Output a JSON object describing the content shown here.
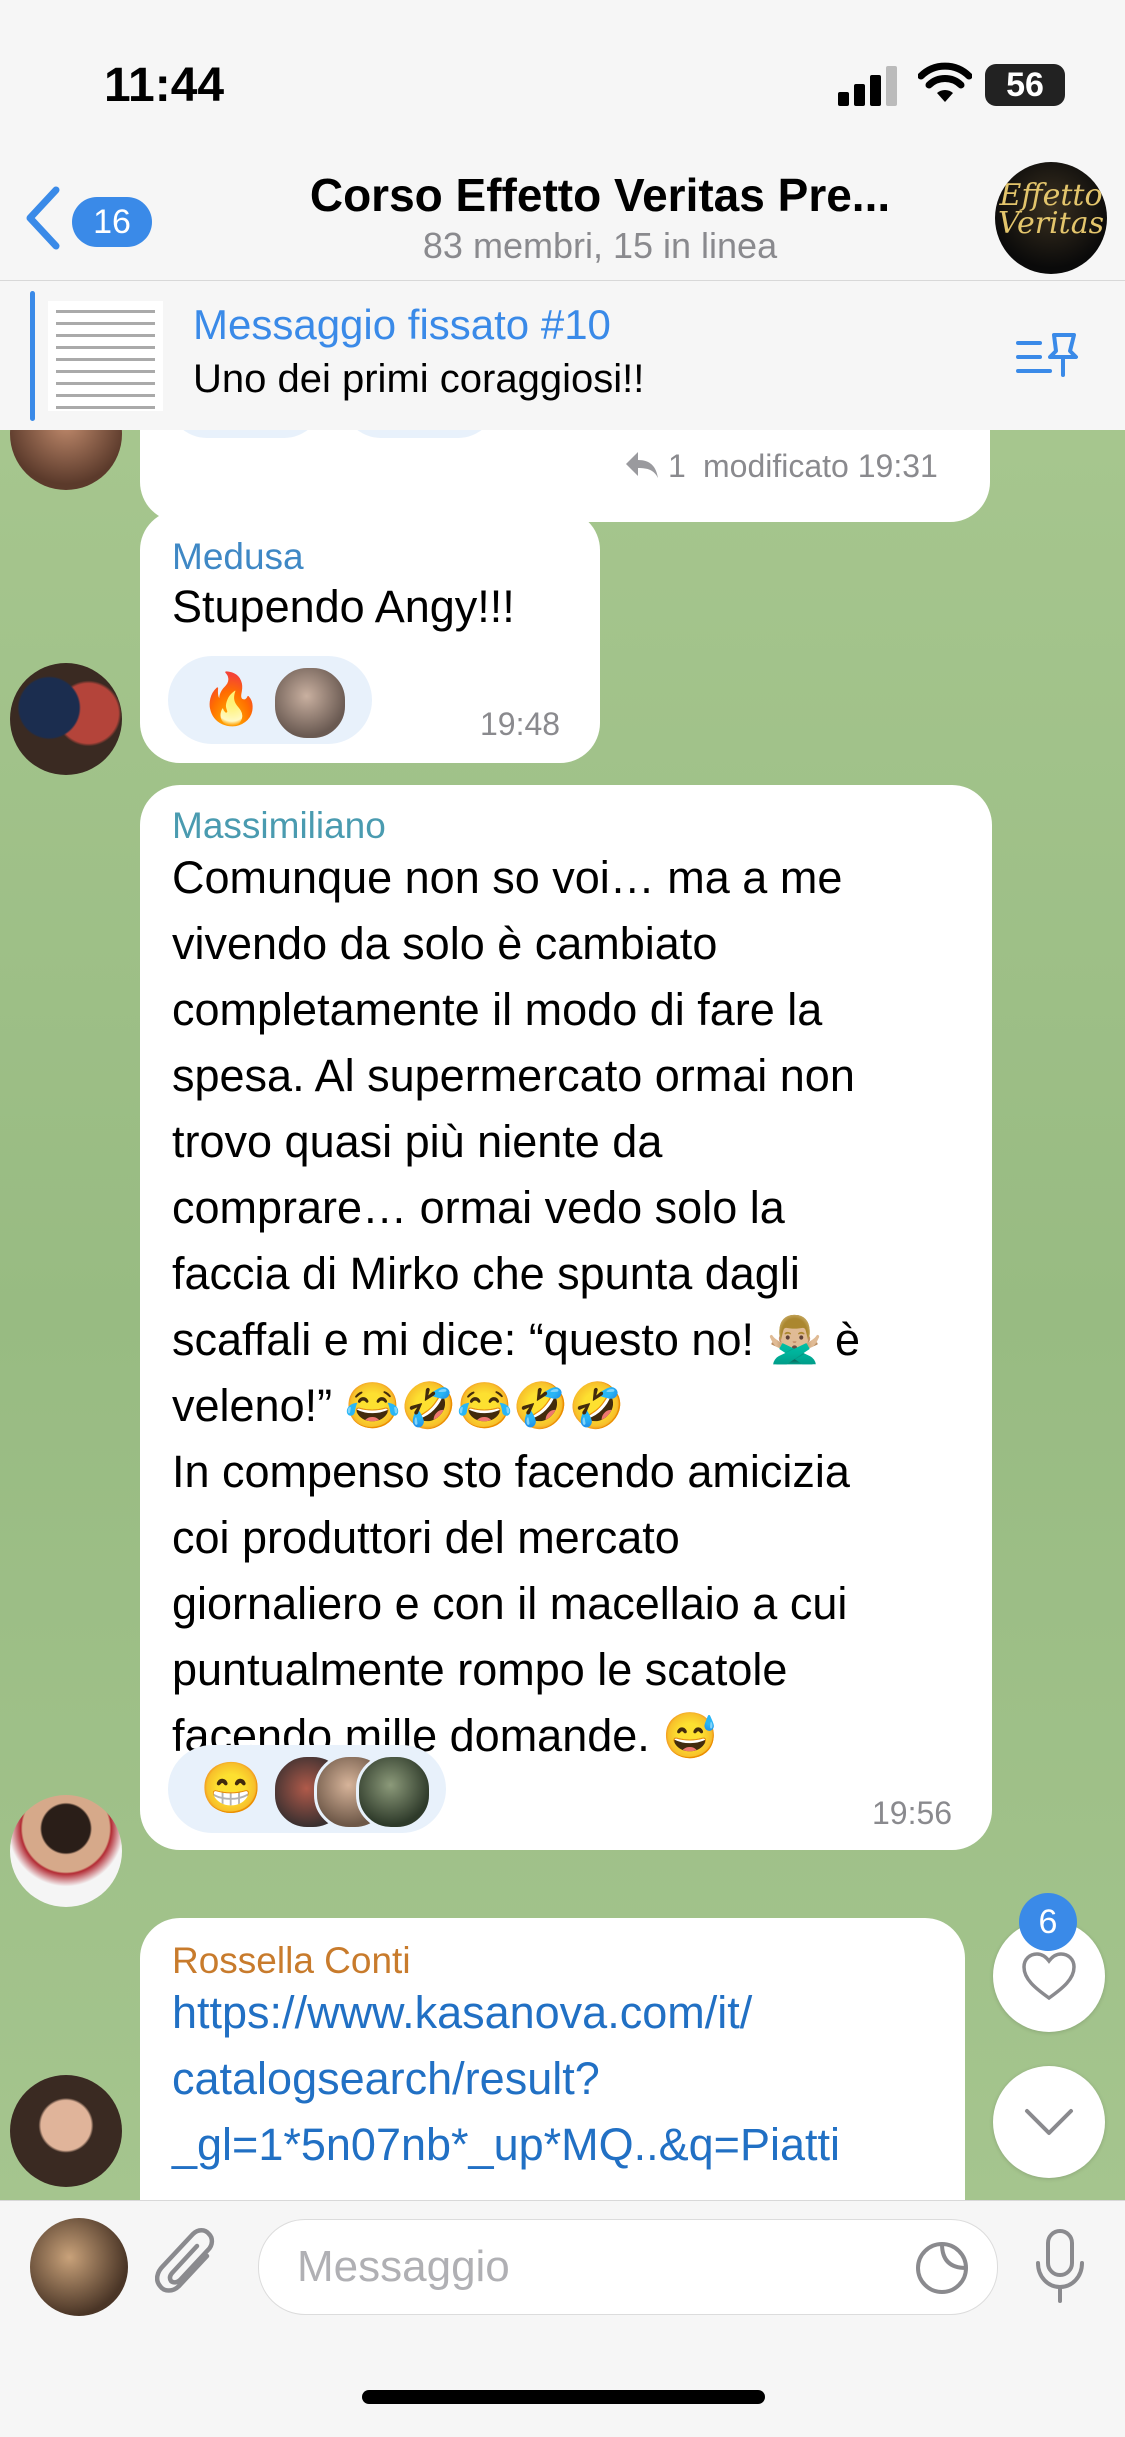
{
  "status_bar": {
    "time": "11:44",
    "battery": "56"
  },
  "header": {
    "back_count": "16",
    "title": "Corso Effetto Veritas Pre...",
    "subtitle": "83 membri, 15 in linea",
    "avatar_text": "Effetto Veritas"
  },
  "pinned": {
    "title": "Messaggio fissato #10",
    "text": "Uno dei primi coraggiosi!!"
  },
  "messages": {
    "m0": {
      "reply_count": "1",
      "edited_time": "modificato 19:31",
      "reaction1": "👍",
      "reaction2": "❤️"
    },
    "m1": {
      "sender": "Medusa",
      "text": "Stupendo Angy!!!",
      "reaction": "🔥",
      "time": "19:48"
    },
    "m2": {
      "sender": "Massimiliano",
      "text": "Comunque non so voi… ma a me\nvivendo da solo è cambiato\ncompletamente il modo di fare la\nspesa. Al supermercato ormai non\ntrovo quasi più niente da\ncomprare… ormai vedo solo la\nfaccia di Mirko che spunta dagli\nscaffali e mi dice: “questo no! 🙅🏼‍♂️ è\nveleno!” 😂🤣😂🤣🤣\nIn compenso sto facendo amicizia\ncoi produttori del mercato\ngiornaliero e con il macellaio a cui\npuntualmente rompo le scatole\nfacendo mille domande. 😅",
      "reaction": "😁",
      "time": "19:56"
    },
    "m3": {
      "sender": "Rossella Conti",
      "text": "https://www.kasanova.com/it/\ncatalogsearch/result?\n_gl=1*5n07nb*_up*MQ..&q=Piatti"
    }
  },
  "reactions_button": {
    "count": "6"
  },
  "input": {
    "placeholder": "Messaggio"
  },
  "colors": {
    "accent": "#3a8ae8",
    "sender_medusa": "#3f88c5",
    "sender_massimiliano": "#4a9bb0",
    "sender_rossella": "#c87b2c",
    "link": "#2170c4",
    "chat_bg": "#a6c68e"
  }
}
